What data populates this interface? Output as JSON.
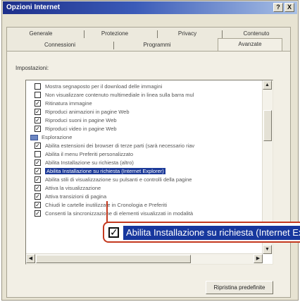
{
  "window": {
    "title": "Opzioni Internet",
    "help_button": "?",
    "close_button": "X"
  },
  "tabs": {
    "row1": [
      "Generale",
      "Protezione",
      "Privacy",
      "Contenuto"
    ],
    "row2": [
      "Connessioni",
      "Programmi",
      "Avanzate"
    ],
    "active": "Avanzate"
  },
  "settings": {
    "label": "Impostazioni:",
    "items": [
      {
        "type": "check",
        "checked": false,
        "label": "Mostra segnaposto per il download delle immagini"
      },
      {
        "type": "check",
        "checked": false,
        "label": "Non visualizzare contenuto multimediale in linea sulla barra mul"
      },
      {
        "type": "check",
        "checked": true,
        "label": "Ritinatura immagine"
      },
      {
        "type": "check",
        "checked": true,
        "label": "Riproduci animazioni in pagine Web"
      },
      {
        "type": "check",
        "checked": true,
        "label": "Riproduci suoni in pagine Web"
      },
      {
        "type": "check",
        "checked": true,
        "label": "Riproduci video in pagine Web"
      },
      {
        "type": "group",
        "label": "Esplorazione"
      },
      {
        "type": "check",
        "checked": true,
        "label": "Abilita estensioni dei browser di terze parti (sarà necessario riav"
      },
      {
        "type": "check",
        "checked": false,
        "label": "Abilita il menu Preferiti personalizzato"
      },
      {
        "type": "check",
        "checked": true,
        "label": "Abilita Installazione su richiesta (altro)"
      },
      {
        "type": "check",
        "checked": true,
        "selected": true,
        "label": "Abilita Installazione su richiesta (Internet Explorer)"
      },
      {
        "type": "check",
        "checked": true,
        "label": "Abilita stili di visualizzazione su pulsanti e controlli della pagine"
      },
      {
        "type": "check",
        "checked": true,
        "label": "Attiva la visualizzazione"
      },
      {
        "type": "check",
        "checked": true,
        "label": "Attiva transizioni di pagina"
      },
      {
        "type": "check",
        "checked": true,
        "label": "Chiudi le cartelle inutilizzate in Cronologia e Preferiti"
      },
      {
        "type": "check",
        "checked": true,
        "label": "Consenti la sincronizzazione di elementi visualizzati in modalità"
      }
    ]
  },
  "buttons": {
    "reset": "Ripristina predefinite"
  },
  "callout": {
    "checkmark": "✓",
    "text": "Abilita Installazione su richiesta (Internet Explorer)"
  },
  "colors": {
    "title_bar": "#1d2f8a",
    "selection": "#1c3a99",
    "callout_border": "#c4391f"
  }
}
